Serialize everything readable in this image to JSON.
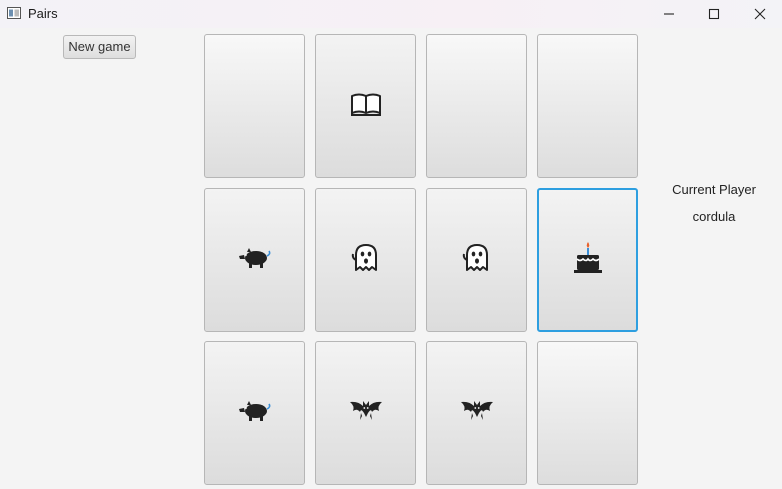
{
  "window": {
    "title": "Pairs"
  },
  "toolbar": {
    "new_game_label": "New game"
  },
  "status": {
    "current_player_label": "Current Player",
    "current_player_name": "cordula"
  },
  "board": {
    "focus_color": "#2e9fe0",
    "cards": [
      {
        "row": 0,
        "col": 0,
        "face": "hidden"
      },
      {
        "row": 0,
        "col": 1,
        "face": "book-icon"
      },
      {
        "row": 0,
        "col": 2,
        "face": "hidden"
      },
      {
        "row": 0,
        "col": 3,
        "face": "hidden"
      },
      {
        "row": 1,
        "col": 0,
        "face": "pig-icon"
      },
      {
        "row": 1,
        "col": 1,
        "face": "ghost-icon"
      },
      {
        "row": 1,
        "col": 2,
        "face": "ghost-icon"
      },
      {
        "row": 1,
        "col": 3,
        "face": "birthday-cake-icon",
        "focused": true
      },
      {
        "row": 2,
        "col": 0,
        "face": "pig-icon"
      },
      {
        "row": 2,
        "col": 1,
        "face": "bat-icon"
      },
      {
        "row": 2,
        "col": 2,
        "face": "bat-icon"
      },
      {
        "row": 2,
        "col": 3,
        "face": "hidden"
      }
    ]
  }
}
